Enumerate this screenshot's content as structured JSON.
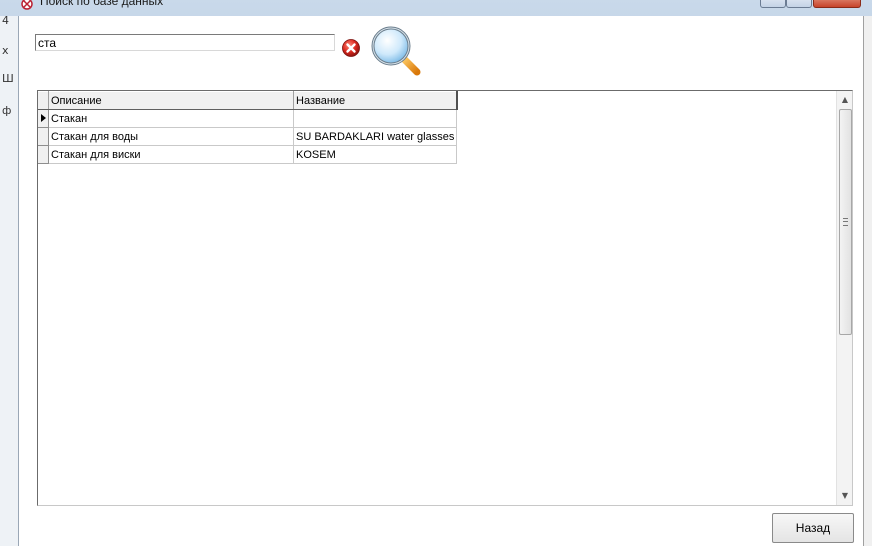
{
  "window": {
    "title": "Поиск по базе данных",
    "left_glyphs": [
      "4",
      "х",
      "Ш",
      "ф"
    ]
  },
  "search": {
    "value": "ста",
    "clear_icon": "clear-x-icon",
    "search_icon": "magnifier-icon"
  },
  "grid": {
    "columns": [
      "Описание",
      "Название"
    ],
    "rows": [
      {
        "description": "Стакан",
        "name": "",
        "current": true
      },
      {
        "description": "Стакан для воды",
        "name": "SU BARDAKLARI water glasses",
        "current": false
      },
      {
        "description": "Стакан для виски",
        "name": "KOSEM",
        "current": false
      }
    ]
  },
  "buttons": {
    "back": "Назад"
  },
  "colors": {
    "clear_red": "#d9281e",
    "magnifier_blue": "#8ec6ec",
    "magnifier_handle": "#f29a1c"
  }
}
